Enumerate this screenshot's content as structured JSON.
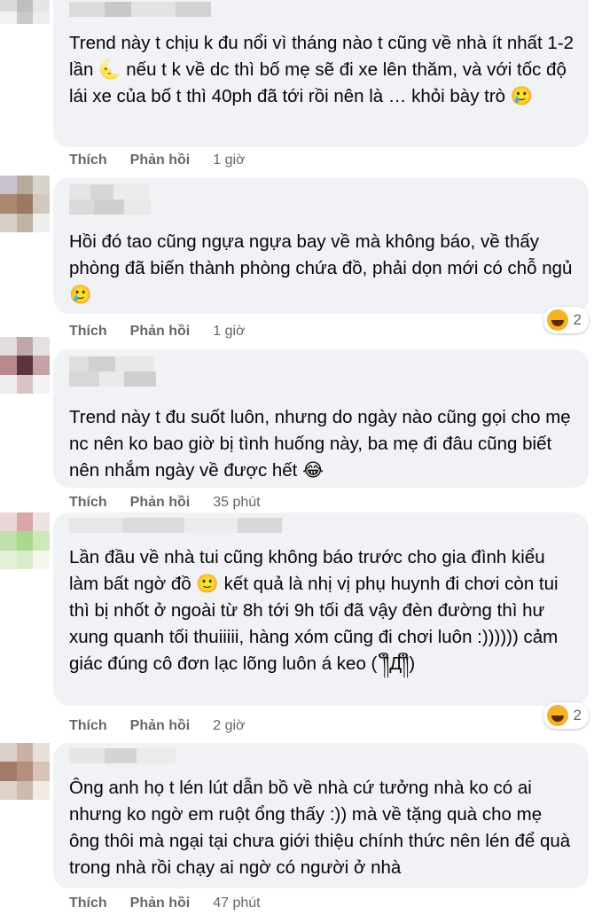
{
  "comments": [
    {
      "text": "Trend này t chịu k đu nổi vì tháng nào t cũng về nhà ít nhất 1-2 lần 🌜 nếu t k về dc thì bố mẹ sẽ đi xe lên thăm, và với tốc độ lái xe của bố t thì 40ph đã tới rồi nên là … khỏi bày trò 🥲",
      "like": "Thích",
      "reply": "Phản hồi",
      "time": "1 giờ"
    },
    {
      "text": "Hồi đó tao cũng ngựa ngựa bay về mà không báo, về thấy phòng đã biến thành phòng chứa đồ, phải dọn mới có chỗ ngủ 🥲",
      "like": "Thích",
      "reply": "Phản hồi",
      "time": "1 giờ",
      "reactions": "2"
    },
    {
      "text": "Trend này t đu suốt luôn, nhưng do ngày nào cũng gọi cho mẹ nc nên ko bao giờ bị tình huống này, ba mẹ đi đâu cũng biết nên nhắm ngày về được hết 😂",
      "like": "Thích",
      "reply": "Phản hồi",
      "time": "35 phút"
    },
    {
      "text": "Lần đầu về nhà tui cũng không báo trước cho gia đình kiểu làm bất ngờ đồ 🙂 kết quả là nhị vị phụ huynh đi chơi còn tui thì bị nhốt ở ngoài từ 8h tới 9h tối đã vậy đèn đường thì hư xung quanh tối thuiiiii, hàng xóm cũng đi chơi luôn :)))))) cảm giác đúng cô đơn lạc lõng luôn á keo ( ༎ຶД༎ຶ)",
      "like": "Thích",
      "reply": "Phản hồi",
      "time": "2 giờ",
      "reactions": "2"
    },
    {
      "text": "Ông anh họ t lén lút dẫn bồ về nhà cứ tưởng nhà ko có ai nhưng ko ngờ em ruột ổng thấy :)) mà về tặng quà cho mẹ ông thôi mà ngại tại chưa giới thiệu chính thức nên lén để quà trong nhà rồi chạy ai ngờ có người ở nhà",
      "like": "Thích",
      "reply": "Phản hồi",
      "time": "47 phút"
    }
  ]
}
